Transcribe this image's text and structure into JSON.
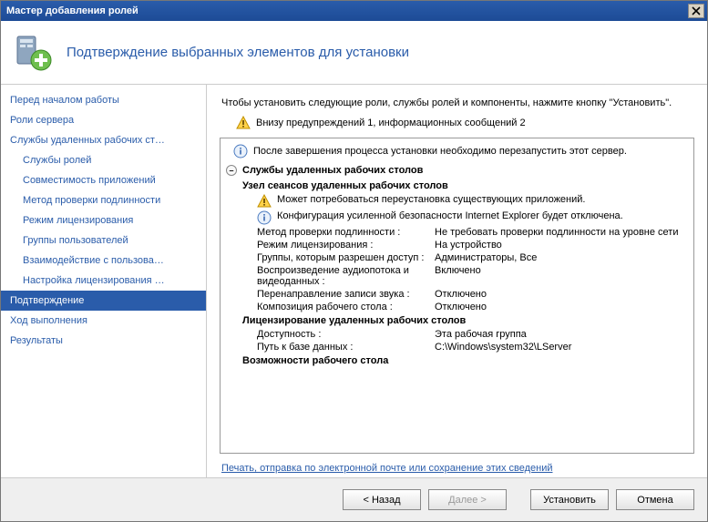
{
  "window": {
    "title": "Мастер добавления ролей"
  },
  "header": {
    "title": "Подтверждение выбранных элементов для установки"
  },
  "sidebar": {
    "items": [
      {
        "label": "Перед началом работы",
        "sub": false
      },
      {
        "label": "Роли сервера",
        "sub": false
      },
      {
        "label": "Службы удаленных рабочих ст…",
        "sub": false
      },
      {
        "label": "Службы ролей",
        "sub": true
      },
      {
        "label": "Совместимость приложений",
        "sub": true
      },
      {
        "label": "Метод проверки подлинности",
        "sub": true
      },
      {
        "label": "Режим лицензирования",
        "sub": true
      },
      {
        "label": "Группы пользователей",
        "sub": true
      },
      {
        "label": "Взаимодействие с пользова…",
        "sub": true
      },
      {
        "label": "Настройка лицензирования …",
        "sub": true
      },
      {
        "label": "Подтверждение",
        "sub": false,
        "active": true
      },
      {
        "label": "Ход выполнения",
        "sub": false
      },
      {
        "label": "Результаты",
        "sub": false
      }
    ]
  },
  "content": {
    "intro": "Чтобы установить следующие роли, службы ролей и компоненты, нажмите кнопку \"Установить\".",
    "warn_summary": "Внизу предупреждений 1, информационных сообщений 2",
    "restart_notice": "После завершения процесса установки необходимо перезапустить этот сервер.",
    "section_title": "Службы удаленных рабочих столов",
    "sub1_title": "Узел сеансов удаленных рабочих столов",
    "sub1_warn": "Может потребоваться переустановка существующих приложений.",
    "sub1_info": "Конфигурация усиленной безопасности Internet Explorer будет отключена.",
    "kv1": [
      {
        "k": "Метод проверки подлинности :",
        "v": "Не требовать проверки подлинности на уровне сети"
      },
      {
        "k": "Режим лицензирования :",
        "v": "На устройство"
      },
      {
        "k": "Группы, которым разрешен доступ :",
        "v": "Администраторы, Все"
      },
      {
        "k": "Воспроизведение аудиопотока и видеоданных :",
        "v": "Включено"
      },
      {
        "k": "Перенаправление записи звука :",
        "v": "Отключено"
      },
      {
        "k": "Композиция рабочего стола :",
        "v": "Отключено"
      }
    ],
    "sub2_title": "Лицензирование удаленных рабочих столов",
    "kv2": [
      {
        "k": "Доступность :",
        "v": "Эта рабочая группа"
      },
      {
        "k": "Путь к базе данных :",
        "v": "C:\\Windows\\system32\\LServer"
      }
    ],
    "sub3_title": "Возможности рабочего стола",
    "link_text": "Печать, отправка по электронной почте или сохранение этих сведений"
  },
  "footer": {
    "back": "< Назад",
    "next": "Далее >",
    "install": "Установить",
    "cancel": "Отмена"
  }
}
